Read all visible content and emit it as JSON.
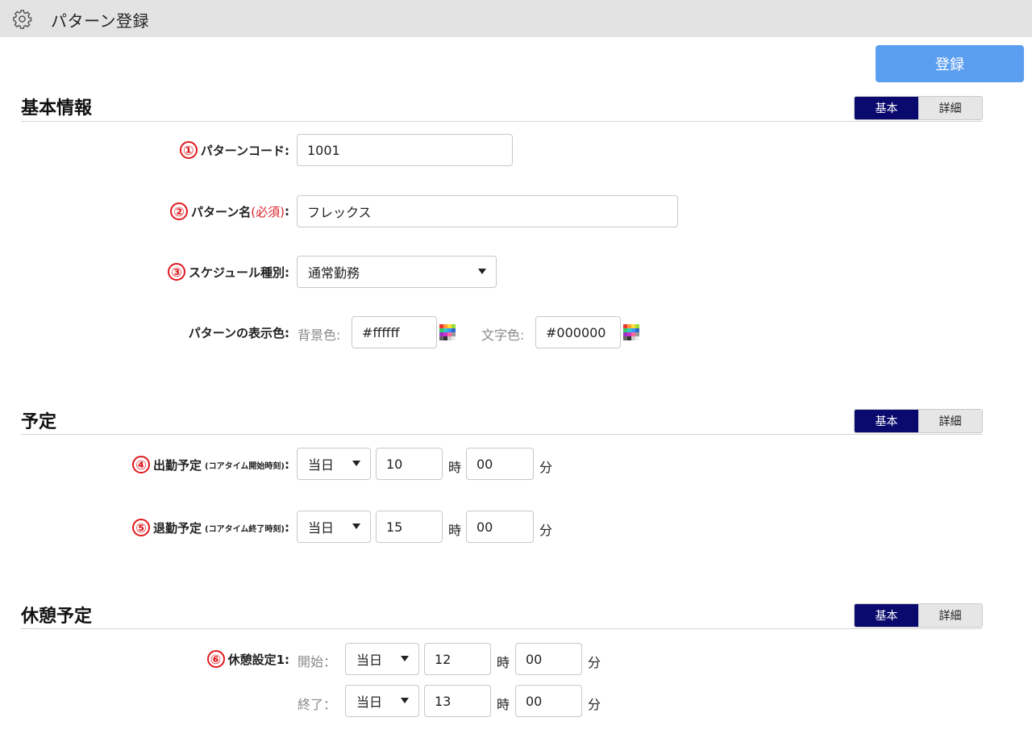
{
  "header": {
    "title": "パターン登録",
    "icon": "gear-icon"
  },
  "register_button": "登録",
  "toggle": {
    "basic": "基本",
    "detail": "詳細"
  },
  "sections": {
    "basic_info": {
      "title": "基本情報"
    },
    "schedule": {
      "title": "予定"
    },
    "break": {
      "title": "休憩予定"
    }
  },
  "markers": [
    "①",
    "②",
    "③",
    "④",
    "⑤",
    "⑥"
  ],
  "fields": {
    "pattern_code": {
      "label": "パターンコード:",
      "value": "1001"
    },
    "pattern_name": {
      "label": "パターン名",
      "required": "(必須)",
      "colon": ":",
      "value": "フレックス"
    },
    "schedule_type": {
      "label": "スケジュール種別:",
      "value": "通常勤務"
    },
    "display_color": {
      "label": "パターンの表示色:",
      "bg_label": "背景色:",
      "bg_value": "#ffffff",
      "text_label": "文字色:",
      "text_value": "#000000"
    },
    "attend": {
      "label": "出勤予定",
      "sub": "(コアタイム開始時刻)",
      "colon": ":",
      "day": "当日",
      "hour": "10",
      "minute": "00"
    },
    "leave": {
      "label": "退勤予定",
      "sub": "(コアタイム終了時刻)",
      "colon": ":",
      "day": "当日",
      "hour": "15",
      "minute": "00"
    },
    "break1": {
      "label": "休憩設定1:",
      "start_label": "開始：",
      "start_day": "当日",
      "start_hour": "12",
      "start_minute": "00",
      "end_label": "終了：",
      "end_day": "当日",
      "end_hour": "13",
      "end_minute": "00"
    }
  },
  "units": {
    "hour": "時",
    "minute": "分"
  },
  "colors": {
    "accent": "#5b9ef0",
    "toggle_active": "#0a0a6e",
    "marker": "#e0191f"
  }
}
